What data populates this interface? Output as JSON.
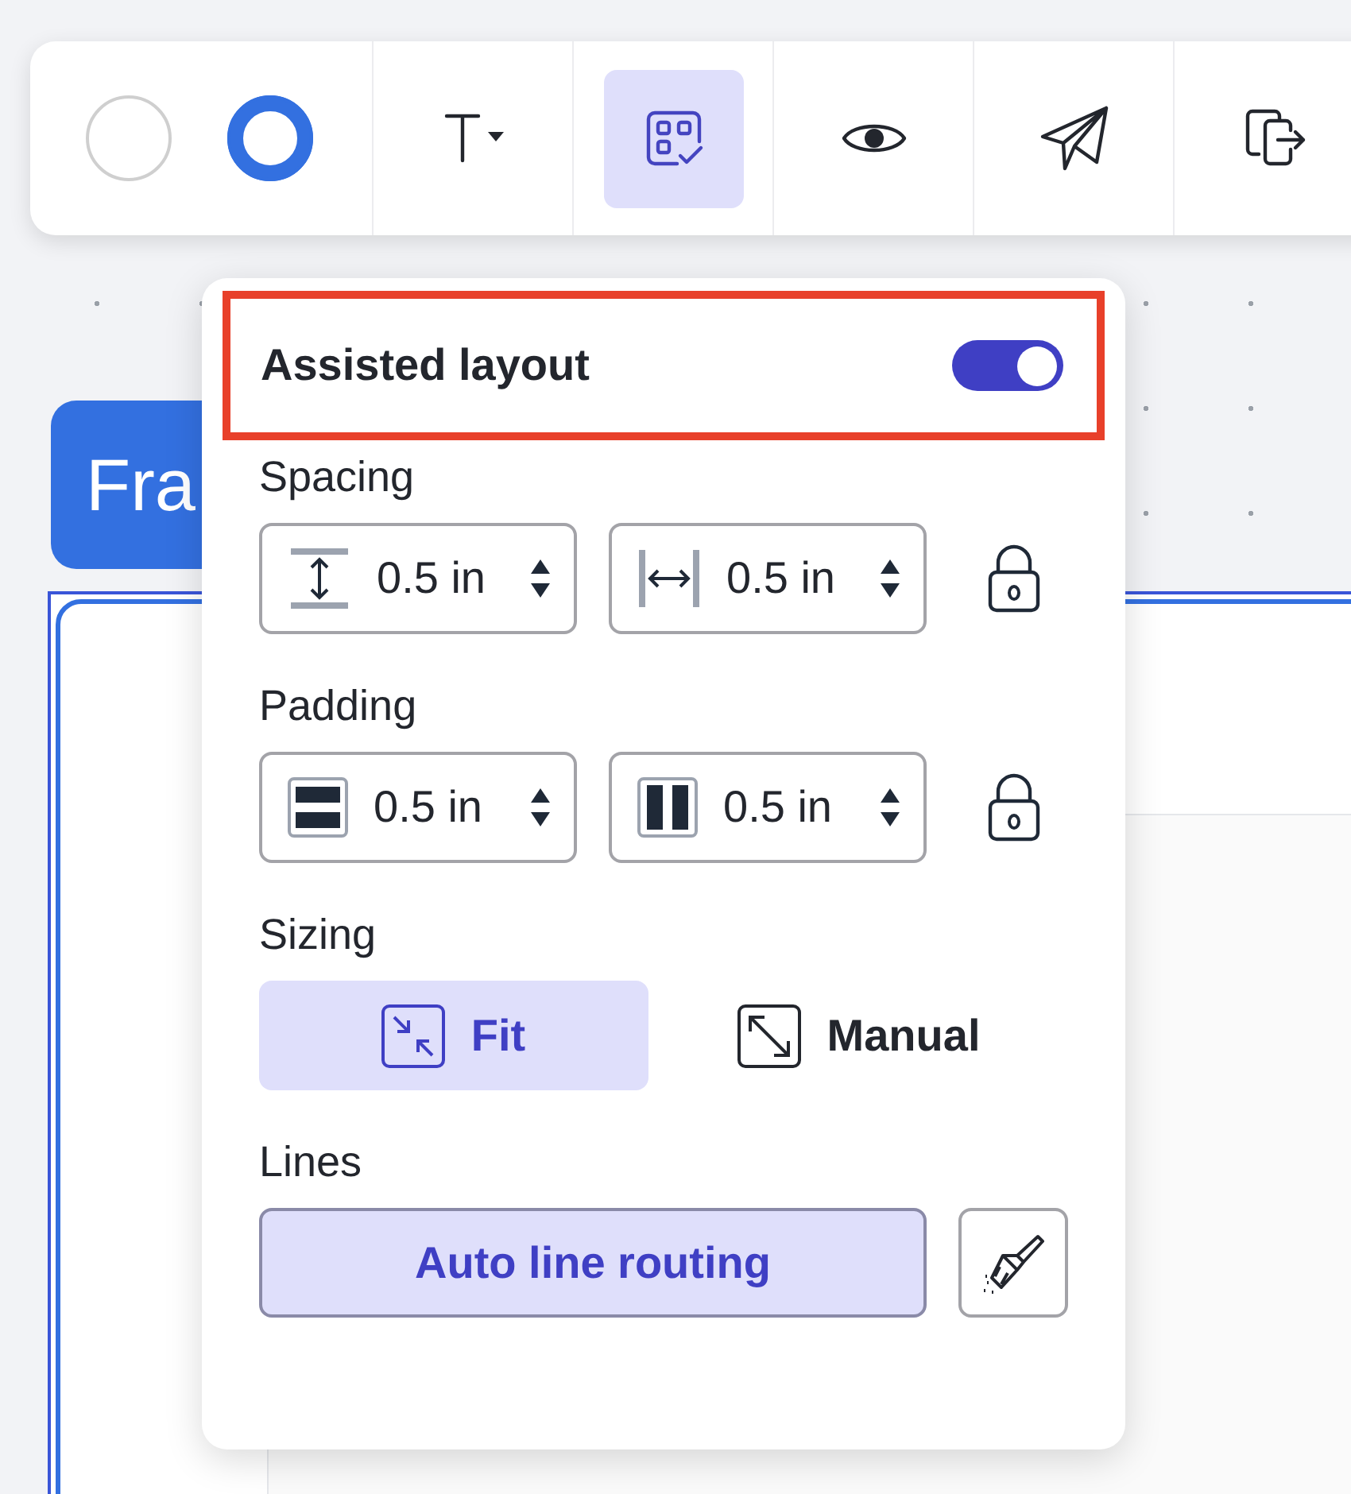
{
  "toolbar": {
    "swatches": [
      {
        "color": "#ffffff",
        "selected": false
      },
      {
        "color": "#3370e0",
        "selected": true
      }
    ],
    "tools": [
      {
        "kind": "text",
        "selected": false
      },
      {
        "kind": "layout",
        "selected": true
      },
      {
        "kind": "eye",
        "selected": false
      },
      {
        "kind": "send",
        "selected": false
      },
      {
        "kind": "export",
        "selected": false
      }
    ]
  },
  "canvas": {
    "frame_label": "Fra"
  },
  "popover": {
    "title": "Assisted layout",
    "highlighted": true,
    "toggle": {
      "on": true
    },
    "sections": [
      {
        "kind": "fields",
        "label": "Spacing",
        "fields": [
          {
            "kind": "vertical-spacing",
            "value": "0.5 in"
          },
          {
            "kind": "horizontal-spacing",
            "value": "0.5 in"
          }
        ],
        "locked": true
      },
      {
        "kind": "fields",
        "label": "Padding",
        "fields": [
          {
            "kind": "vertical-padding",
            "value": "0.5 in"
          },
          {
            "kind": "horizontal-padding",
            "value": "0.5 in"
          }
        ],
        "locked": true
      },
      {
        "kind": "options",
        "label": "Sizing",
        "options": [
          {
            "kind": "fit",
            "label": "Fit",
            "selected": true
          },
          {
            "kind": "manual",
            "label": "Manual",
            "selected": false
          }
        ]
      },
      {
        "kind": "lines",
        "label": "Lines",
        "button": {
          "label": "Auto line routing",
          "selected": true
        }
      }
    ]
  }
}
